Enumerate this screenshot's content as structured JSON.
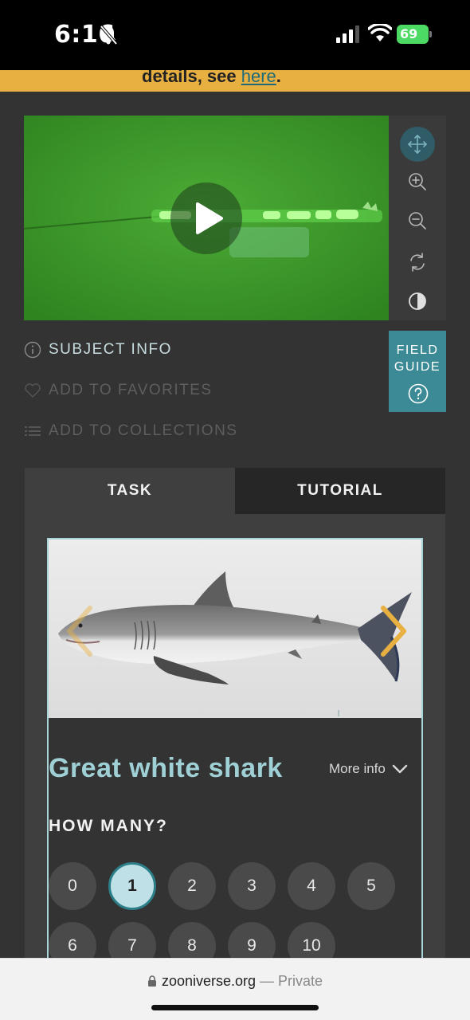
{
  "status_bar": {
    "time": "6:16",
    "battery": "69",
    "icons": [
      "bell-off-icon",
      "cellular-signal-icon",
      "wifi-icon",
      "battery-charging-icon"
    ]
  },
  "banner": {
    "text_prefix": "details, see ",
    "link_text": "here",
    "text_suffix": "."
  },
  "viewer": {
    "play_icon": "play-icon",
    "tools": [
      "move-icon",
      "zoom-in-icon",
      "zoom-out-icon",
      "rotate-icon",
      "invert-icon"
    ],
    "active_tool": "move-icon"
  },
  "meta_links": {
    "subject_info": "SUBJECT INFO",
    "add_to_favorites": "ADD TO FAVORITES",
    "add_to_collections": "ADD TO COLLECTIONS"
  },
  "field_guide": {
    "line1": "FIELD",
    "line2": "GUIDE"
  },
  "tabs": {
    "task": "TASK",
    "tutorial": "TUTORIAL",
    "active": "TASK"
  },
  "species_card": {
    "name": "Great white shark",
    "more_info": "More info",
    "how_many_label": "HOW MANY?",
    "options": [
      "0",
      "1",
      "2",
      "3",
      "4",
      "5",
      "6",
      "7",
      "8",
      "9",
      "10"
    ],
    "selected": "1"
  },
  "browser": {
    "domain": "zooniverse.org",
    "separator": " — ",
    "mode": "Private"
  },
  "colors": {
    "banner": "#e8b040",
    "accent": "#3b8a96",
    "species_name": "#9fd0d5",
    "video_green": "#3c9a2a"
  }
}
